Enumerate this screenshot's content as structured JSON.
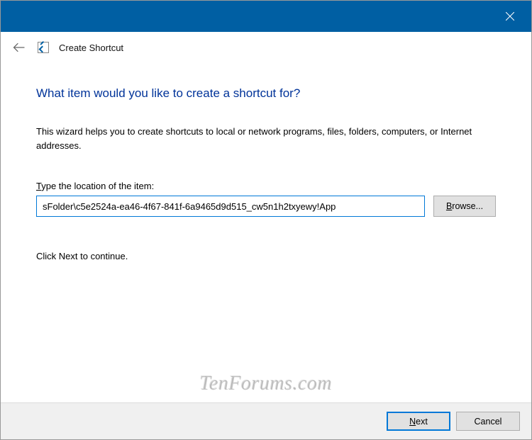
{
  "titlebar": {
    "window_title": "Create Shortcut"
  },
  "content": {
    "heading": "What item would you like to create a shortcut for?",
    "description": "This wizard helps you to create shortcuts to local or network programs, files, folders, computers, or Internet addresses.",
    "location_label_pre": "T",
    "location_label_post": "ype the location of the item:",
    "location_value": "sFolder\\c5e2524a-ea46-4f67-841f-6a9465d9d515_cw5n1h2txyewy!App",
    "browse_pre": "B",
    "browse_post": "rowse...",
    "continue_text": "Click Next to continue."
  },
  "footer": {
    "next_pre": "N",
    "next_post": "ext",
    "cancel": "Cancel"
  },
  "watermark": "TenForums.com"
}
